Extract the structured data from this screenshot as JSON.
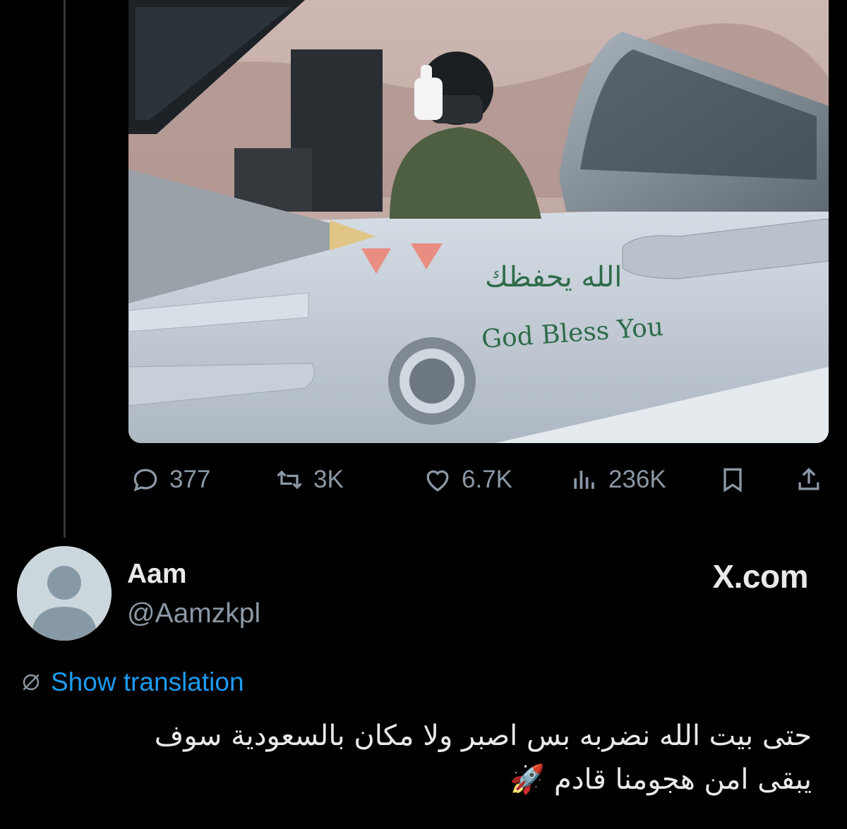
{
  "media": {
    "aircraft_arabic_text": "الله يحفظك",
    "aircraft_english_text": "God Bless You"
  },
  "actions": {
    "replies": "377",
    "reposts": "3K",
    "likes": "6.7K",
    "views": "236K"
  },
  "reply_tweet": {
    "display_name": "Aam",
    "handle": "@Aamzkpl",
    "watermark": "X.com",
    "show_translation": "Show translation",
    "text_line_1": "حتى بيت الله نضربه بس اصبر ولا مكان بالسعودية سوف",
    "text_line_2": "يبقى امن هجومنا قادم 🚀"
  },
  "colors": {
    "background": "#000000",
    "text_primary": "#e7e9ea",
    "text_secondary": "#8b98a5",
    "link": "#1d9bf0",
    "inscription_green": "#2f6b4a"
  }
}
